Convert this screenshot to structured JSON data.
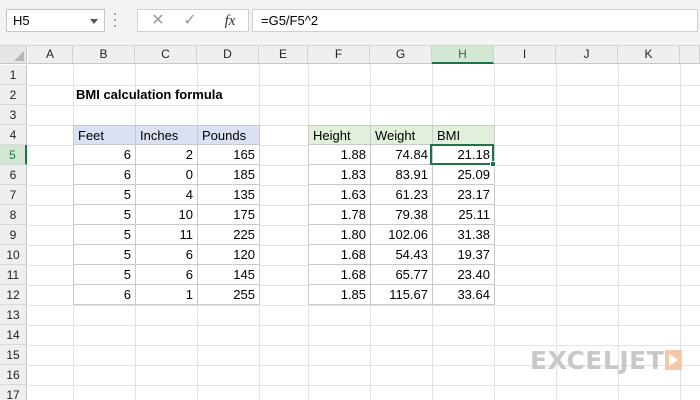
{
  "formula_bar": {
    "name_box": "H5",
    "cancel_icon": "✕",
    "enter_icon": "✓",
    "fx_label": "fx",
    "formula": "=G5/F5^2"
  },
  "columns": [
    "A",
    "B",
    "C",
    "D",
    "E",
    "F",
    "G",
    "H",
    "I",
    "J",
    "K"
  ],
  "active_column": "H",
  "rows": [
    "1",
    "2",
    "3",
    "4",
    "5",
    "6",
    "7",
    "8",
    "9",
    "10",
    "11",
    "12",
    "13",
    "14",
    "15",
    "16",
    "17"
  ],
  "active_row": "5",
  "sheet_title": "BMI calculation formula",
  "input_table": {
    "headers": [
      "Feet",
      "Inches",
      "Pounds"
    ],
    "rows": [
      [
        "6",
        "2",
        "165"
      ],
      [
        "6",
        "0",
        "185"
      ],
      [
        "5",
        "4",
        "135"
      ],
      [
        "5",
        "10",
        "175"
      ],
      [
        "5",
        "11",
        "225"
      ],
      [
        "5",
        "6",
        "120"
      ],
      [
        "5",
        "6",
        "145"
      ],
      [
        "6",
        "1",
        "255"
      ]
    ]
  },
  "result_table": {
    "headers": [
      "Height",
      "Weight",
      "BMI"
    ],
    "rows": [
      [
        "1.88",
        "74.84",
        "21.18"
      ],
      [
        "1.83",
        "83.91",
        "25.09"
      ],
      [
        "1.63",
        "61.23",
        "23.17"
      ],
      [
        "1.78",
        "79.38",
        "25.11"
      ],
      [
        "1.80",
        "102.06",
        "31.38"
      ],
      [
        "1.68",
        "54.43",
        "19.37"
      ],
      [
        "1.68",
        "65.77",
        "23.40"
      ],
      [
        "1.85",
        "115.67",
        "33.64"
      ]
    ]
  },
  "watermark": "EXCELJET",
  "colors": {
    "accent_green": "#217346",
    "input_header_bg": "#dbe1f3",
    "result_header_bg": "#e2efda"
  }
}
